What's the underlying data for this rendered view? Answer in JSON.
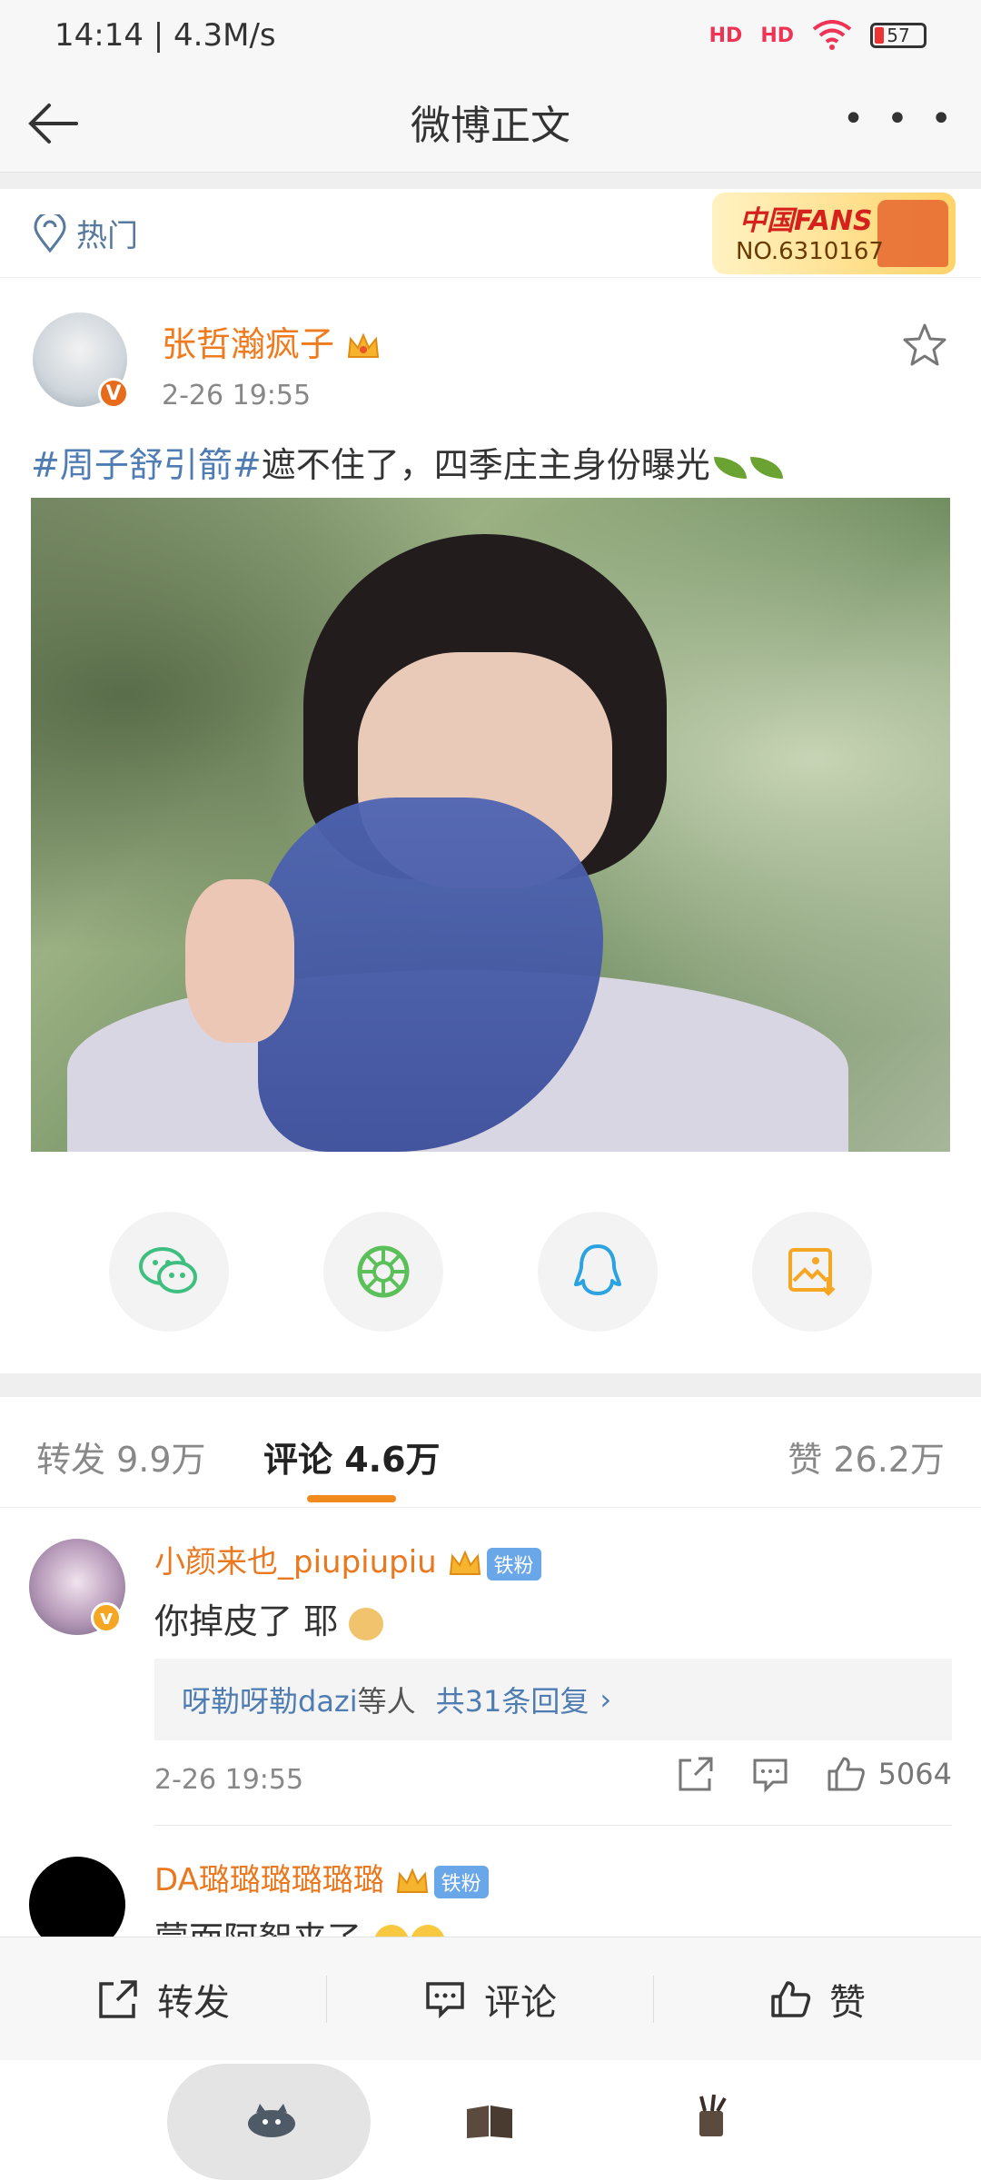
{
  "status_bar": {
    "time_speed": "14:14 | 4.3M/s",
    "signal1": "HD",
    "signal2": "HD",
    "battery": "57"
  },
  "nav": {
    "title": "微博正文"
  },
  "hot": {
    "label": "热门",
    "fans_title": "中国FANS",
    "fans_no": "NO.6310167"
  },
  "post": {
    "author": "张哲瀚疯子",
    "time": "2-26 19:55",
    "hashtag": "#周子舒引箭#",
    "text": "遮不住了，四季庄主身份曝光"
  },
  "share_icons": [
    "wechat-icon",
    "moments-icon",
    "qq-icon",
    "save-image-icon"
  ],
  "tabs": {
    "repost": "转发 9.9万",
    "comment": "评论 4.6万",
    "like": "赞 26.2万"
  },
  "comments": [
    {
      "name": "小颜来也_piupiupiu",
      "badge": "铁粉",
      "text": "你掉皮了 耶",
      "reply_user": "呀勒呀勒dazi",
      "reply_mid": "等人",
      "reply_count": "共31条回复",
      "time": "2-26 19:55",
      "likes": "5064"
    },
    {
      "name": "DA璐璐璐璐璐璐",
      "badge": "铁粉",
      "text": "蒙面阿絮来了"
    }
  ],
  "bottom_bar": {
    "repost": "转发",
    "comment": "评论",
    "like": "赞"
  },
  "colors": {
    "accent": "#f08a1d",
    "link": "#4f7cb3",
    "username": "#f07a1e"
  }
}
